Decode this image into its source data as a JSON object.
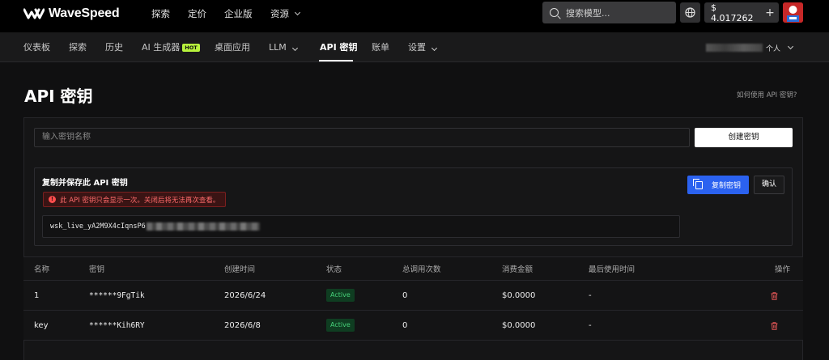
{
  "brand": {
    "name": "WaveSpeed"
  },
  "topnav": [
    {
      "label": "探索"
    },
    {
      "label": "定价"
    },
    {
      "label": "企业版"
    },
    {
      "label": "资源"
    }
  ],
  "search": {
    "placeholder": "搜索模型..."
  },
  "balance": {
    "amount": "$ 4.017262",
    "add": "+"
  },
  "subnav": {
    "items": [
      {
        "label": "仪表板"
      },
      {
        "label": "探索"
      },
      {
        "label": "历史"
      },
      {
        "label": "AI 生成器",
        "badge": "HOT"
      },
      {
        "label": "桌面应用"
      },
      {
        "label": "LLM"
      },
      {
        "label": "API 密钥",
        "active": true
      },
      {
        "label": "账单"
      },
      {
        "label": "设置"
      }
    ],
    "account_type": "个人"
  },
  "page": {
    "title": "API 密钥",
    "help_link": "如何使用 API 密钥?"
  },
  "create": {
    "placeholder": "输入密钥名称",
    "button": "创建密钥"
  },
  "new_key": {
    "title": "复制并保存此 API 密钥",
    "warning": "此 API 密钥只会显示一次。关闭后将无法再次查看。",
    "key_prefix": "wsk_live_yA2M9X4cIqnsP6",
    "copy_button": "复制密钥",
    "confirm_button": "确认"
  },
  "table": {
    "columns": [
      "名称",
      "密钥",
      "创建时间",
      "状态",
      "总调用次数",
      "消费金额",
      "最后使用时间",
      "操作"
    ],
    "rows": [
      {
        "name": "1",
        "key": "******9FgTik",
        "created": "2026/6/24",
        "status": "Active",
        "calls": "0",
        "cost": "$0.0000",
        "last_used": "-"
      },
      {
        "name": "key",
        "key": "******Kih6RY",
        "created": "2026/6/8",
        "status": "Active",
        "calls": "0",
        "cost": "$0.0000",
        "last_used": "-"
      }
    ]
  },
  "colors": {
    "accent_blue": "#2b62f0",
    "hot_badge": "#b7f23c",
    "active_badge_text": "#47d27a",
    "warning_text": "#ff6b6b",
    "delete_icon": "#e05555"
  }
}
